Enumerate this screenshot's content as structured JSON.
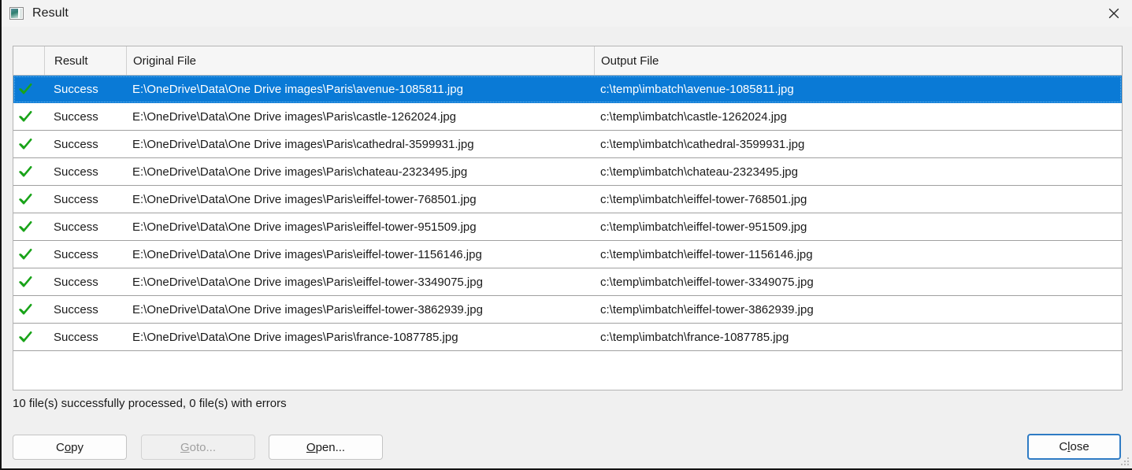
{
  "window": {
    "title": "Result",
    "icon": "image-thumbnail-icon",
    "close_icon": "close-icon"
  },
  "table": {
    "columns": [
      "",
      "Result",
      "Original File",
      "Output File"
    ],
    "rows": [
      {
        "status_icon": "green-check-icon",
        "result": "Success",
        "original_file": "E:\\OneDrive\\Data\\One Drive images\\Paris\\avenue-1085811.jpg",
        "output_file": "c:\\temp\\imbatch\\avenue-1085811.jpg",
        "selected": true
      },
      {
        "status_icon": "green-check-icon",
        "result": "Success",
        "original_file": "E:\\OneDrive\\Data\\One Drive images\\Paris\\castle-1262024.jpg",
        "output_file": "c:\\temp\\imbatch\\castle-1262024.jpg",
        "selected": false
      },
      {
        "status_icon": "green-check-icon",
        "result": "Success",
        "original_file": "E:\\OneDrive\\Data\\One Drive images\\Paris\\cathedral-3599931.jpg",
        "output_file": "c:\\temp\\imbatch\\cathedral-3599931.jpg",
        "selected": false
      },
      {
        "status_icon": "green-check-icon",
        "result": "Success",
        "original_file": "E:\\OneDrive\\Data\\One Drive images\\Paris\\chateau-2323495.jpg",
        "output_file": "c:\\temp\\imbatch\\chateau-2323495.jpg",
        "selected": false
      },
      {
        "status_icon": "green-check-icon",
        "result": "Success",
        "original_file": "E:\\OneDrive\\Data\\One Drive images\\Paris\\eiffel-tower-768501.jpg",
        "output_file": "c:\\temp\\imbatch\\eiffel-tower-768501.jpg",
        "selected": false
      },
      {
        "status_icon": "green-check-icon",
        "result": "Success",
        "original_file": "E:\\OneDrive\\Data\\One Drive images\\Paris\\eiffel-tower-951509.jpg",
        "output_file": "c:\\temp\\imbatch\\eiffel-tower-951509.jpg",
        "selected": false
      },
      {
        "status_icon": "green-check-icon",
        "result": "Success",
        "original_file": "E:\\OneDrive\\Data\\One Drive images\\Paris\\eiffel-tower-1156146.jpg",
        "output_file": "c:\\temp\\imbatch\\eiffel-tower-1156146.jpg",
        "selected": false
      },
      {
        "status_icon": "green-check-icon",
        "result": "Success",
        "original_file": "E:\\OneDrive\\Data\\One Drive images\\Paris\\eiffel-tower-3349075.jpg",
        "output_file": "c:\\temp\\imbatch\\eiffel-tower-3349075.jpg",
        "selected": false
      },
      {
        "status_icon": "green-check-icon",
        "result": "Success",
        "original_file": "E:\\OneDrive\\Data\\One Drive images\\Paris\\eiffel-tower-3862939.jpg",
        "output_file": "c:\\temp\\imbatch\\eiffel-tower-3862939.jpg",
        "selected": false
      },
      {
        "status_icon": "green-check-icon",
        "result": "Success",
        "original_file": "E:\\OneDrive\\Data\\One Drive images\\Paris\\france-1087785.jpg",
        "output_file": "c:\\temp\\imbatch\\france-1087785.jpg",
        "selected": false
      }
    ]
  },
  "status_text": "10 file(s) successfully processed, 0 file(s) with errors",
  "buttons": {
    "copy": {
      "label": "Copy",
      "mnemonic": "o",
      "state": "enabled"
    },
    "goto": {
      "label": "Goto...",
      "mnemonic": "G",
      "state": "disabled"
    },
    "open": {
      "label": "Open...",
      "mnemonic": "O",
      "state": "enabled"
    },
    "close": {
      "label": "Close",
      "mnemonic": "l",
      "state": "default"
    }
  },
  "colors": {
    "selection_blue": "#0a7ad6",
    "success_green": "#19a319",
    "default_button_border": "#2e7bc4",
    "window_background": "#f0f0f0",
    "list_background": "#ffffff"
  }
}
